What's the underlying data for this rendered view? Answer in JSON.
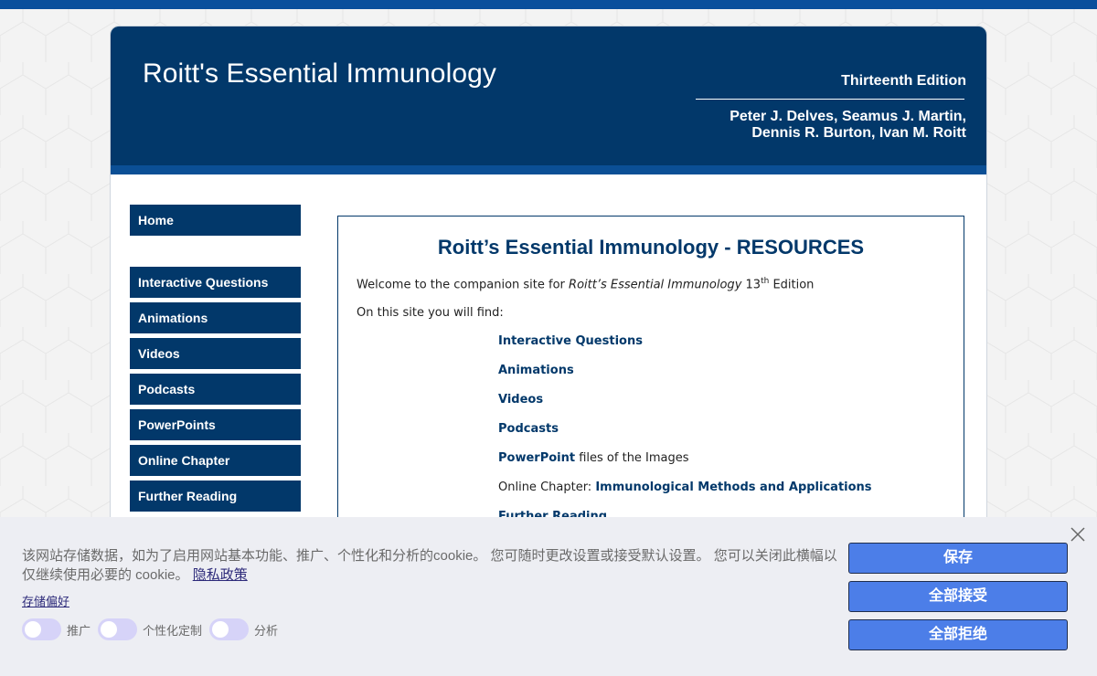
{
  "header": {
    "site_title": "Roitt's Essential Immunology",
    "edition": "Thirteenth Edition",
    "authors_line1": "Peter J. Delves, Seamus J. Martin,",
    "authors_line2": "Dennis R. Burton, Ivan M. Roitt"
  },
  "nav": {
    "home": "Home",
    "items": [
      "Interactive Questions",
      "Animations",
      "Videos",
      "Podcasts",
      "PowerPoints",
      "Online Chapter",
      "Further Reading"
    ]
  },
  "content": {
    "heading": "Roitt’s Essential Immunology - RESOURCES",
    "welcome_prefix": "Welcome to the companion site for ",
    "welcome_book": "Roitt’s Essential Immunology",
    "welcome_num": " 13",
    "welcome_sup": "th",
    "welcome_suffix": " Edition",
    "find_text": "On this site you will find:",
    "resources": {
      "interactive": "Interactive Questions",
      "animations": "Animations",
      "videos": "Videos",
      "podcasts": "Podcasts",
      "powerpoint_link": "PowerPoint",
      "powerpoint_suffix": " files of the Images",
      "online_prefix": "Online Chapter: ",
      "online_link": "Immunological Methods and Applications",
      "further": "Further Reading"
    }
  },
  "cookie": {
    "message": "该网站存储数据，如为了启用网站基本功能、推广、个性化和分析的cookie。 您可随时更改设置或接受默认设置。 您可以关闭此横幅以仅继续使用必要的 cookie。",
    "privacy_link": "隐私政策",
    "prefs_link": "存储偏好",
    "toggle_labels": [
      "推广",
      "个性化定制",
      "分析"
    ],
    "save_label": "保存",
    "accept_all_label": "全部接受",
    "reject_all_label": "全部拒绝"
  },
  "colors": {
    "brand_navy": "#02386a",
    "brand_blue": "#0b4f95",
    "button_blue": "#4c7ee8",
    "toggle_off": "#d6d3f8"
  },
  "icons": {
    "close": "close-icon"
  }
}
